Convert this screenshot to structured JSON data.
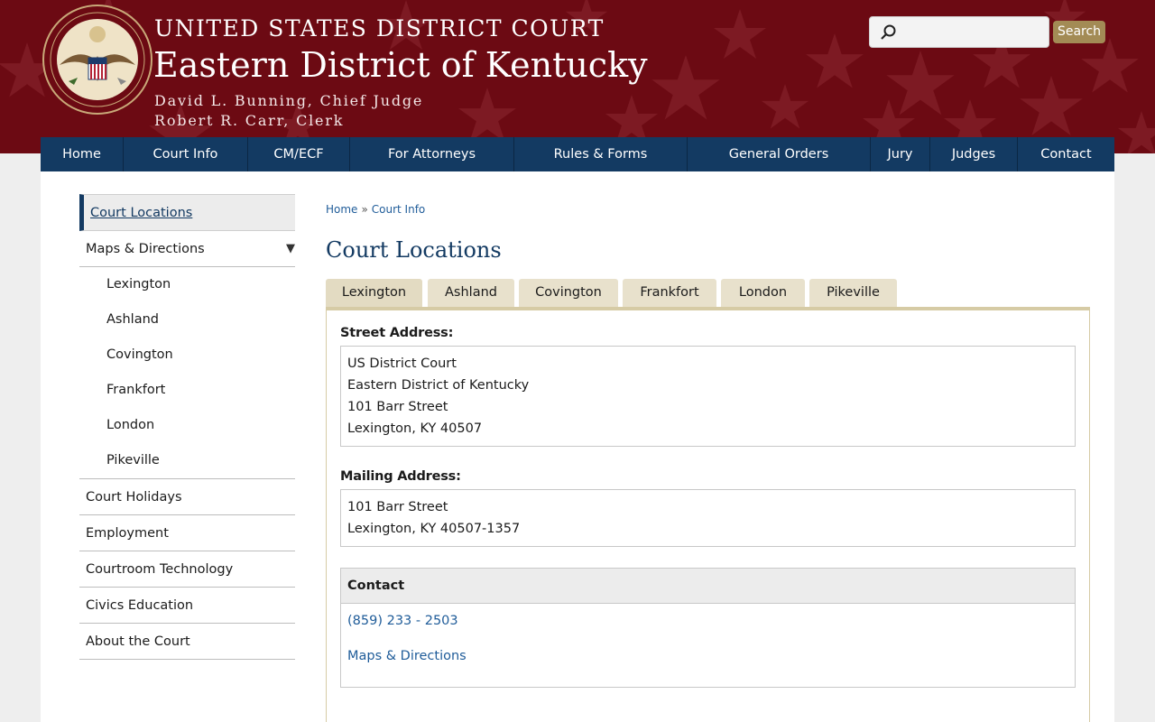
{
  "header": {
    "court_name": "UNITED STATES DISTRICT COURT",
    "district_name": "Eastern District of Kentucky",
    "chief_judge": "David L. Bunning, Chief Judge",
    "clerk": "Robert R. Carr, Clerk",
    "seal_text_top": "UNITED STATES DISTRICT COURT",
    "seal_text_bottom": "Eastern District of Kentucky",
    "search_placeholder": "",
    "search_button": "Search",
    "colors": {
      "background": "#6c0a13",
      "search_button": "#a38b55"
    }
  },
  "nav": {
    "items": [
      "Home",
      "Court Info",
      "CM/ECF",
      "For Attorneys",
      "Rules & Forms",
      "General Orders",
      "Jury",
      "Judges",
      "Contact"
    ],
    "color": "#133a62"
  },
  "sidebar": {
    "active": "Court Locations",
    "maps_label": "Maps & Directions",
    "maps_sub": [
      "Lexington",
      "Ashland",
      "Covington",
      "Frankfort",
      "London",
      "Pikeville"
    ],
    "items": [
      "Court Holidays",
      "Employment",
      "Courtroom Technology",
      "Civics Education",
      "About the Court"
    ]
  },
  "breadcrumb": {
    "home": "Home",
    "separator": "»",
    "current": "Court Info"
  },
  "page_title": "Court Locations",
  "tabs": [
    "Lexington",
    "Ashland",
    "Covington",
    "Frankfort",
    "London",
    "Pikeville"
  ],
  "active_tab": "Lexington",
  "location": {
    "street_label": "Street Address:",
    "street_lines": [
      "US District Court",
      "Eastern District of Kentucky",
      "101 Barr Street",
      "Lexington, KY 40507"
    ],
    "mailing_label": "Mailing Address:",
    "mailing_lines": [
      "101 Barr Street",
      "Lexington, KY 40507-1357"
    ],
    "contact_label": "Contact",
    "phone": "(859) 233 - 2503",
    "directions_link": "Maps & Directions"
  }
}
